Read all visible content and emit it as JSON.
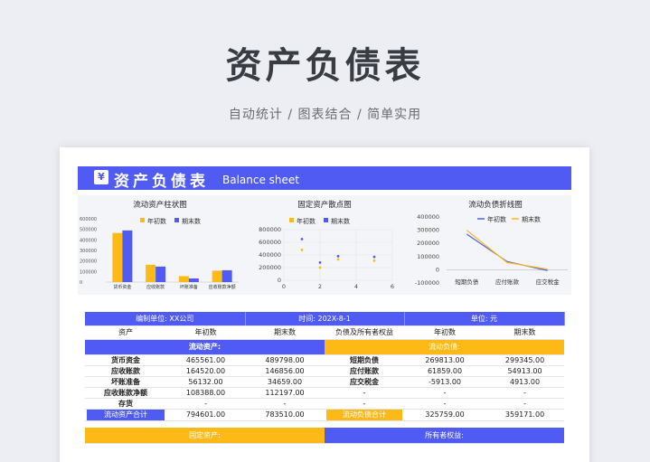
{
  "hero": {
    "title": "资产负债表",
    "subtitle": "自动统计 / 图表结合 / 简单实用"
  },
  "banner": {
    "icon": "¥",
    "title_cn": "资产负债表",
    "title_en": "Balance sheet"
  },
  "colors": {
    "accent_blue": "#4f5bf3",
    "accent_yellow": "#fdba16",
    "line_begin": "#4f5bf3",
    "line_end": "#fdba16"
  },
  "chart_data": [
    {
      "type": "bar",
      "title": "流动资产柱状图",
      "categories": [
        "货币资金",
        "应收账款",
        "坏账准备",
        "应收账款净额"
      ],
      "series": [
        {
          "name": "年初数",
          "values": [
            465561,
            164520,
            56132,
            108388
          ]
        },
        {
          "name": "期末数",
          "values": [
            489798,
            146856,
            34659,
            112197
          ]
        }
      ],
      "y_ticks": [
        "600000",
        "500000",
        "400000",
        "300000",
        "200000",
        "100000",
        "0"
      ],
      "ylim": [
        0,
        600000
      ]
    },
    {
      "type": "scatter",
      "title": "固定资产散点图",
      "series": [
        {
          "name": "年初数",
          "points": [
            [
              1,
              650000
            ],
            [
              2,
              280000
            ],
            [
              3,
              380000
            ],
            [
              5,
              370000
            ]
          ]
        },
        {
          "name": "期末数",
          "points": [
            [
              1,
              480000
            ],
            [
              2,
              200000
            ],
            [
              3,
              330000
            ],
            [
              5,
              310000
            ]
          ]
        }
      ],
      "x_ticks": [
        "0",
        "2",
        "4",
        "6"
      ],
      "y_ticks": [
        "800000",
        "600000",
        "400000",
        "200000",
        "0"
      ],
      "xlim": [
        0,
        6
      ],
      "ylim": [
        0,
        800000
      ]
    },
    {
      "type": "line",
      "title": "流动负债折线图",
      "categories": [
        "短期负债",
        "应付账款",
        "应交税金"
      ],
      "series": [
        {
          "name": "年初数",
          "values": [
            269813,
            61859,
            -5913
          ]
        },
        {
          "name": "期末数",
          "values": [
            299345,
            54913,
            4913
          ]
        }
      ],
      "y_ticks": [
        "400000",
        "300000",
        "200000",
        "100000",
        "0",
        "-100000"
      ],
      "ylim": [
        -100000,
        400000
      ]
    }
  ],
  "table": {
    "meta": {
      "unit_label": "编制单位: XX公司",
      "time_label": "时间: 202X-8-1",
      "currency_label": "单位: 元"
    },
    "headers": [
      "资产",
      "年初数",
      "期末数",
      "负债及所有者权益",
      "年初数",
      "期末数"
    ],
    "current_assets_label": "流动资产:",
    "current_liab_label": "流动负债:",
    "rows": [
      [
        "货币资金",
        "465561.00",
        "489798.00",
        "短期负债",
        "269813.00",
        "299345.00"
      ],
      [
        "应收账款",
        "164520.00",
        "146856.00",
        "应付账款",
        "61859.00",
        "54913.00"
      ],
      [
        "坏账准备",
        "56132.00",
        "34659.00",
        "应交税金",
        "-5913.00",
        "4913.00"
      ],
      [
        "应收账款净额",
        "108388.00",
        "112197.00",
        "-",
        "-",
        "-"
      ],
      [
        "存货",
        "-",
        "-",
        "-",
        "-",
        "-"
      ]
    ],
    "totals": [
      "流动资产合计",
      "794601.00",
      "783510.00",
      "流动负债合计",
      "325759.00",
      "359171.00"
    ],
    "fixed_assets_label": "固定资产:",
    "equity_label": "所有者权益:"
  }
}
